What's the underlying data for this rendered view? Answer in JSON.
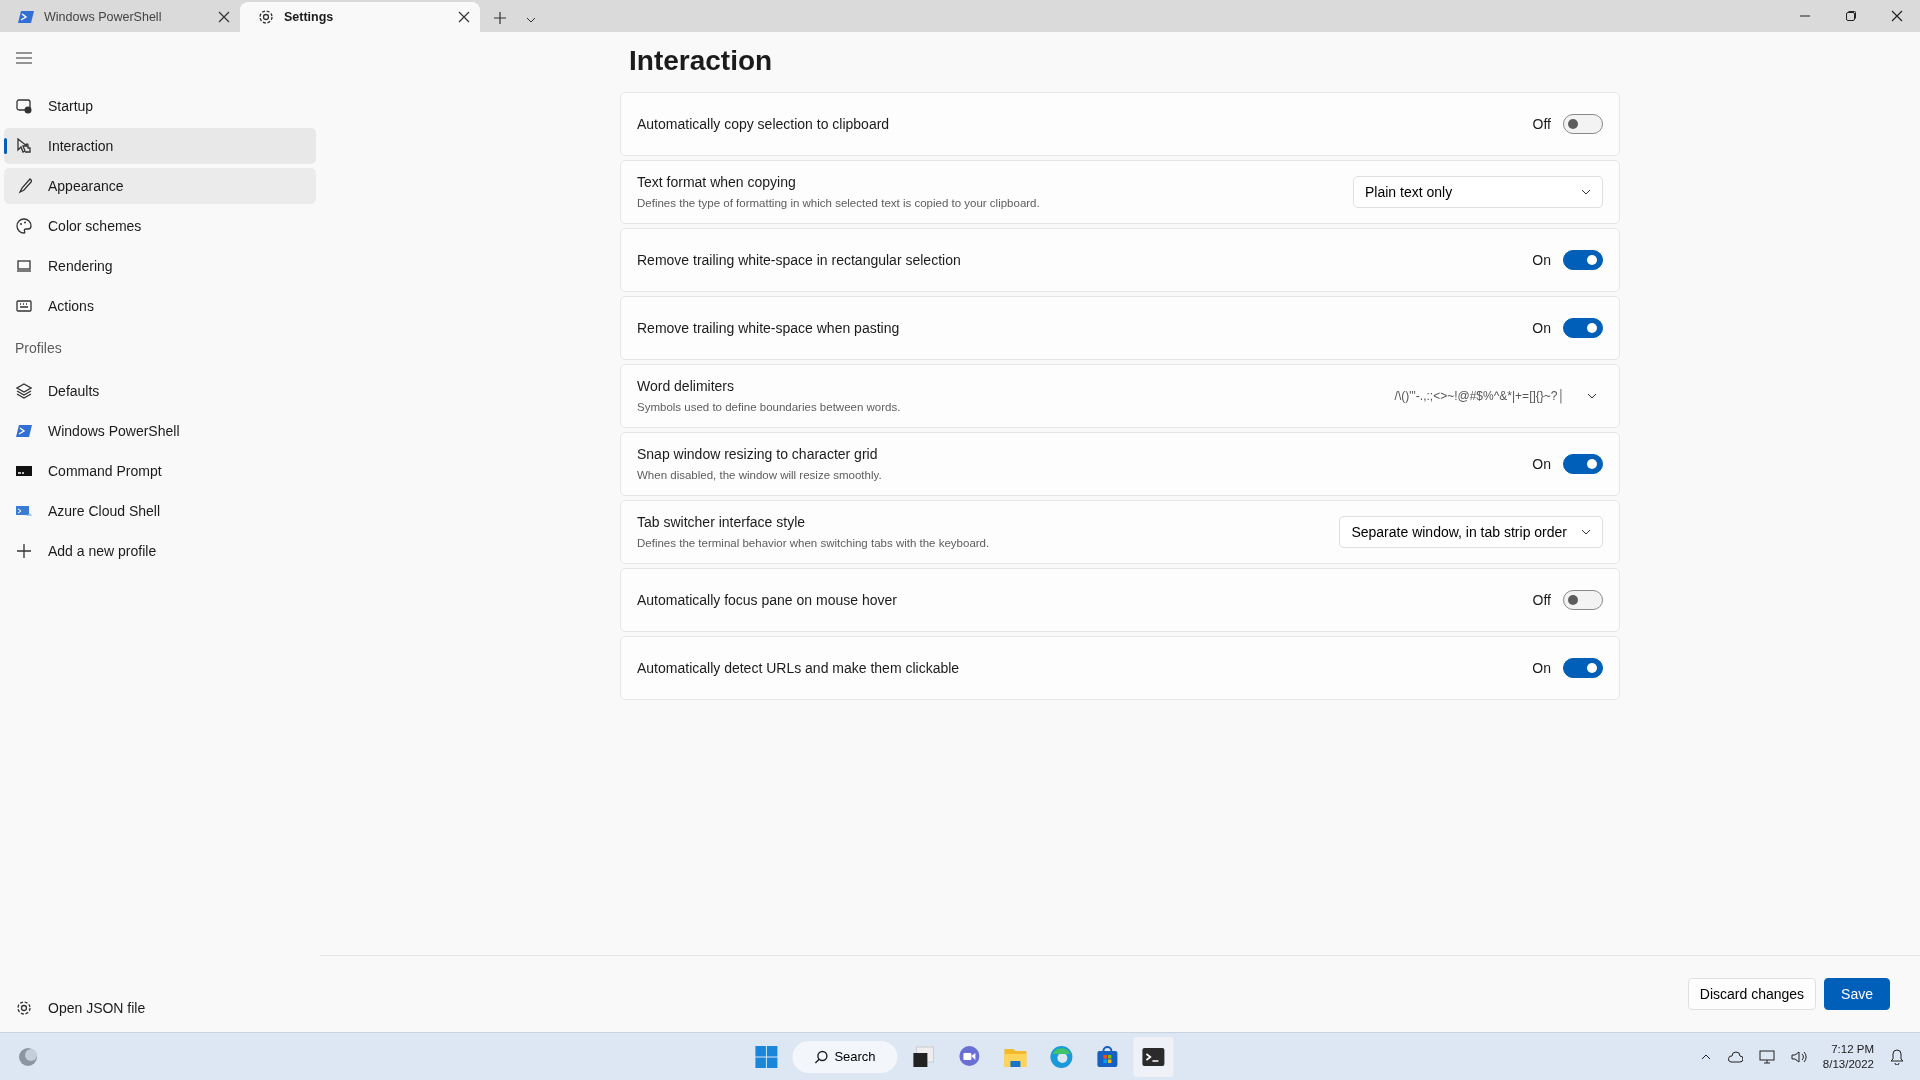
{
  "tabs": [
    {
      "title": "Windows PowerShell",
      "selected": false
    },
    {
      "title": "Settings",
      "selected": true
    }
  ],
  "sidebar": {
    "items": [
      {
        "label": "Startup",
        "selected": false,
        "hovered": false
      },
      {
        "label": "Interaction",
        "selected": true,
        "hovered": false
      },
      {
        "label": "Appearance",
        "selected": false,
        "hovered": true
      },
      {
        "label": "Color schemes",
        "selected": false,
        "hovered": false
      },
      {
        "label": "Rendering",
        "selected": false,
        "hovered": false
      },
      {
        "label": "Actions",
        "selected": false,
        "hovered": false
      }
    ],
    "section": "Profiles",
    "profiles": [
      {
        "label": "Defaults"
      },
      {
        "label": "Windows PowerShell"
      },
      {
        "label": "Command Prompt"
      },
      {
        "label": "Azure Cloud Shell"
      },
      {
        "label": "Add a new profile"
      }
    ],
    "footer": "Open JSON file"
  },
  "page": {
    "title": "Interaction",
    "rows": [
      {
        "kind": "toggle",
        "label": "Automatically copy selection to clipboard",
        "state": "Off",
        "on": false
      },
      {
        "kind": "dropdown",
        "label": "Text format when copying",
        "description": "Defines the type of formatting in which selected text is copied to your clipboard.",
        "value": "Plain text only"
      },
      {
        "kind": "toggle",
        "label": "Remove trailing white-space in rectangular selection",
        "state": "On",
        "on": true
      },
      {
        "kind": "toggle",
        "label": "Remove trailing white-space when pasting",
        "state": "On",
        "on": true
      },
      {
        "kind": "expander",
        "label": "Word delimiters",
        "description": "Symbols used to define boundaries between words.",
        "value": "/\\()\"'-.,:;<>~!@#$%^&*|+=[]{}~?│"
      },
      {
        "kind": "toggle",
        "label": "Snap window resizing to character grid",
        "description": "When disabled, the window will resize smoothly.",
        "state": "On",
        "on": true
      },
      {
        "kind": "dropdown",
        "label": "Tab switcher interface style",
        "description": "Defines the terminal behavior when switching tabs with the keyboard.",
        "value": "Separate window, in tab strip order"
      },
      {
        "kind": "toggle",
        "label": "Automatically focus pane on mouse hover",
        "state": "Off",
        "on": false
      },
      {
        "kind": "toggle",
        "label": "Automatically detect URLs and make them clickable",
        "state": "On",
        "on": true
      }
    ],
    "buttons": [
      {
        "label": "Discard changes",
        "primary": false
      },
      {
        "label": "Save",
        "primary": true
      }
    ]
  },
  "taskbar": {
    "search": "Search",
    "time": "7:12 PM",
    "date": "8/13/2022"
  }
}
